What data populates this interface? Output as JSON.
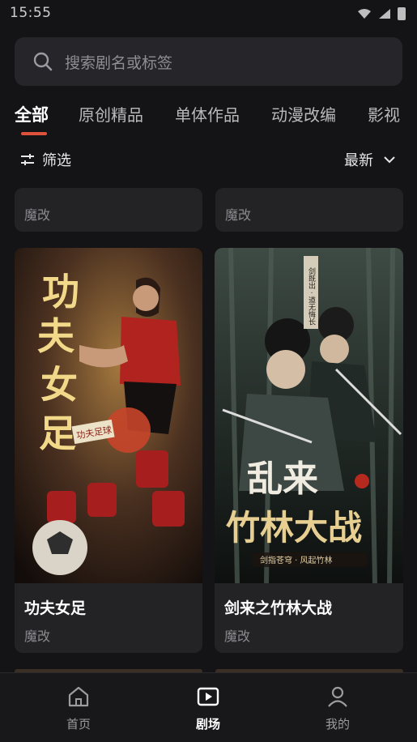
{
  "status": {
    "time": "15:55"
  },
  "search": {
    "placeholder": "搜索剧名或标签"
  },
  "tabs": [
    {
      "label": "全部",
      "active": true
    },
    {
      "label": "原创精品",
      "active": false
    },
    {
      "label": "单体作品",
      "active": false
    },
    {
      "label": "动漫改编",
      "active": false
    },
    {
      "label": "影视",
      "active": false
    }
  ],
  "filter": {
    "label": "筛选"
  },
  "sort": {
    "label": "最新"
  },
  "cards": [
    {
      "title": "",
      "tag": "魔改"
    },
    {
      "title": "",
      "tag": "魔改"
    },
    {
      "title": "功夫女足",
      "tag": "魔改",
      "poster_text": [
        "功",
        "夫",
        "女",
        "足"
      ],
      "poster_caption": "功夫足球"
    },
    {
      "title": "剑来之竹林大战",
      "tag": "魔改",
      "poster_text": [
        "乱来",
        "竹林大战"
      ],
      "poster_subtitle": "剑指苍穹 · 风起竹林",
      "poster_vertical": "剑既出 · 道无悔长"
    }
  ],
  "nav": [
    {
      "label": "首页",
      "icon": "home-icon",
      "active": false
    },
    {
      "label": "剧场",
      "icon": "theater-play-icon",
      "active": true
    },
    {
      "label": "我的",
      "icon": "profile-icon",
      "active": false
    }
  ],
  "colors": {
    "accent": "#e0513c",
    "background": "#141416",
    "card": "#232326"
  }
}
